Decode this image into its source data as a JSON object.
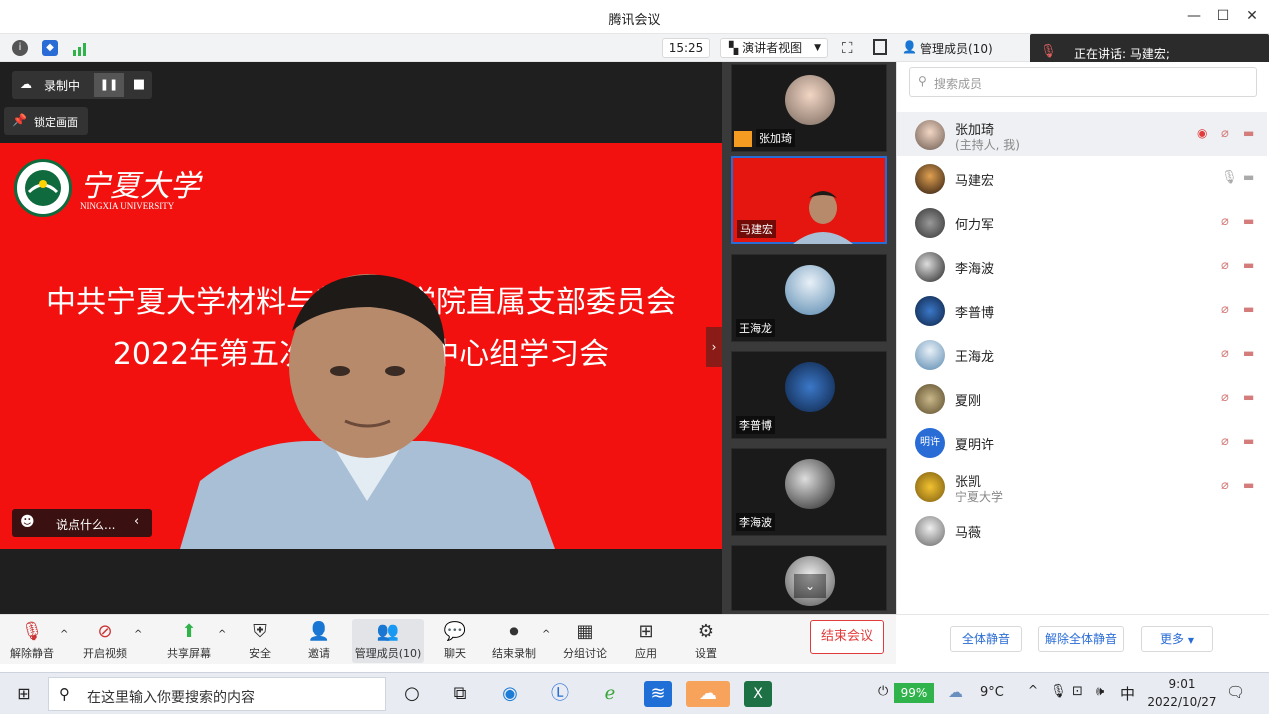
{
  "window": {
    "title": "腾讯会议"
  },
  "infobar": {
    "timer": "15:25",
    "view_label": "演讲者视图"
  },
  "recording": {
    "label": "录制中",
    "lock_label": "锁定画面"
  },
  "slide": {
    "university_name_cn": "宁夏大学",
    "university_name_en": "NINGXIA UNIVERSITY",
    "line1": "中共宁夏大学材料与新能源学院直属支部委员会",
    "line2": "2022年第五次理论学习中心组学习会",
    "line3": "2022年10月"
  },
  "chat_hint": "说点什么...",
  "thumbs": [
    {
      "name": "张加琦"
    },
    {
      "name": "马建宏"
    },
    {
      "name": "王海龙"
    },
    {
      "name": "李普博"
    },
    {
      "name": "李海波"
    }
  ],
  "panel": {
    "title": "管理成员(10)",
    "speaking": "正在讲话: 马建宏;",
    "search_placeholder": "搜索成员",
    "members": [
      {
        "name": "张加琦",
        "sub": "(主持人, 我)"
      },
      {
        "name": "马建宏",
        "sub": ""
      },
      {
        "name": "何力军",
        "sub": ""
      },
      {
        "name": "李海波",
        "sub": ""
      },
      {
        "name": "李普博",
        "sub": ""
      },
      {
        "name": "王海龙",
        "sub": ""
      },
      {
        "name": "夏刚",
        "sub": ""
      },
      {
        "name": "夏明许",
        "sub": "",
        "avatar_text": "明许"
      },
      {
        "name": "张凯",
        "sub": "宁夏大学"
      },
      {
        "name": "马薇",
        "sub": ""
      }
    ],
    "footer": {
      "mute_all": "全体静音",
      "unmute_all": "解除全体静音",
      "more": "更多"
    }
  },
  "toolbar": {
    "unmute": "解除静音",
    "video": "开启视频",
    "share": "共享屏幕",
    "security": "安全",
    "invite": "邀请",
    "members": "管理成员(10)",
    "chat": "聊天",
    "stop_record": "结束录制",
    "breakout": "分组讨论",
    "apps": "应用",
    "settings": "设置",
    "end_meeting": "结束会议"
  },
  "taskbar": {
    "search_placeholder": "在这里输入你要搜索的内容",
    "battery": "99%",
    "temperature": "9°C",
    "ime": "中",
    "time": "9:01",
    "date": "2022/10/27"
  },
  "colors": {
    "slide_red": "#f2110f",
    "accent_blue": "#2a6cd6",
    "end_red": "#e23b3b"
  }
}
